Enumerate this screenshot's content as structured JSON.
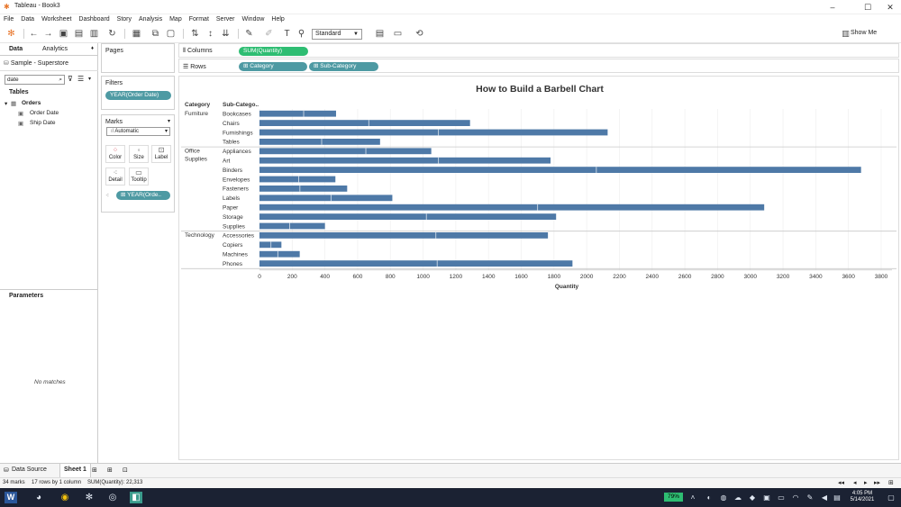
{
  "window": {
    "title": "Tableau - Book3"
  },
  "menu": [
    "File",
    "Data",
    "Worksheet",
    "Dashboard",
    "Story",
    "Analysis",
    "Map",
    "Format",
    "Server",
    "Window",
    "Help"
  ],
  "toolbar": {
    "fit": "Standard",
    "show_me": "Show Me"
  },
  "data_pane": {
    "tab_data": "Data",
    "tab_analytics": "Analytics",
    "datasource": "Sample - Superstore",
    "search": "date",
    "tables_heading": "Tables",
    "table_name": "Orders",
    "fields": [
      "Order Date",
      "Ship Date"
    ],
    "parameters_heading": "Parameters",
    "no_matches": "No matches"
  },
  "cards": {
    "pages": "Pages",
    "filters": "Filters",
    "filter_pill": "YEAR(Order Date)",
    "marks": "Marks",
    "mark_type": "Automatic",
    "buttons": {
      "color": "Color",
      "size": "Size",
      "label": "Label",
      "detail": "Detail",
      "tooltip": "Tooltip"
    },
    "detail_pill": "YEAR(Orde.."
  },
  "shelves": {
    "columns_label": "Columns",
    "columns_pill": "SUM(Quantity)",
    "rows_label": "Rows",
    "rows_pills": [
      "Category",
      "Sub-Category"
    ]
  },
  "chart_data": {
    "type": "bar",
    "title": "How to Build a Barbell Chart",
    "xlabel": "Quantity",
    "header_category": "Category",
    "header_subcategory": "Sub-Catego..",
    "xlim": [
      0,
      3800
    ],
    "xticks": [
      "0",
      "200",
      "400",
      "600",
      "800",
      "1000",
      "1200",
      "1400",
      "1600",
      "1800",
      "2000",
      "2200",
      "2400",
      "2600",
      "2800",
      "3000",
      "3200",
      "3400",
      "3600",
      "3800"
    ],
    "bar_color": "#4e79a7",
    "groups": [
      {
        "category": [
          "Furniture"
        ],
        "items": [
          {
            "name": "Bookcases",
            "value": 468,
            "split": 270
          },
          {
            "name": "Chairs",
            "value": 1287,
            "split": 668
          },
          {
            "name": "Furnishings",
            "value": 2128,
            "split": 1094
          },
          {
            "name": "Tables",
            "value": 737,
            "split": 380
          }
        ]
      },
      {
        "category": [
          "Office",
          "Supplies"
        ],
        "items": [
          {
            "name": "Appliances",
            "value": 1050,
            "split": 650
          },
          {
            "name": "Art",
            "value": 1779,
            "split": 1094
          },
          {
            "name": "Binders",
            "value": 3677,
            "split": 2059
          },
          {
            "name": "Envelopes",
            "value": 464,
            "split": 240
          },
          {
            "name": "Fasteners",
            "value": 536,
            "split": 247
          },
          {
            "name": "Labels",
            "value": 812,
            "split": 437
          },
          {
            "name": "Paper",
            "value": 3085,
            "split": 1700
          },
          {
            "name": "Storage",
            "value": 1813,
            "split": 1020
          },
          {
            "name": "Supplies",
            "value": 400,
            "split": 184
          }
        ]
      },
      {
        "category": [
          "Technology"
        ],
        "items": [
          {
            "name": "Accessories",
            "value": 1763,
            "split": 1078
          },
          {
            "name": "Copiers",
            "value": 134,
            "split": 70
          },
          {
            "name": "Machines",
            "value": 246,
            "split": 112
          },
          {
            "name": "Phones",
            "value": 1913,
            "split": 1086
          }
        ]
      }
    ]
  },
  "sheet_tabs": {
    "datasource": "Data Source",
    "sheet": "Sheet 1"
  },
  "status": {
    "marks": "34 marks",
    "rows": "17 rows by 1 column",
    "sum": "SUM(Quantity): 22,313"
  },
  "taskbar": {
    "battery": "79%",
    "time": "4:05 PM",
    "date": "5/14/2021"
  }
}
